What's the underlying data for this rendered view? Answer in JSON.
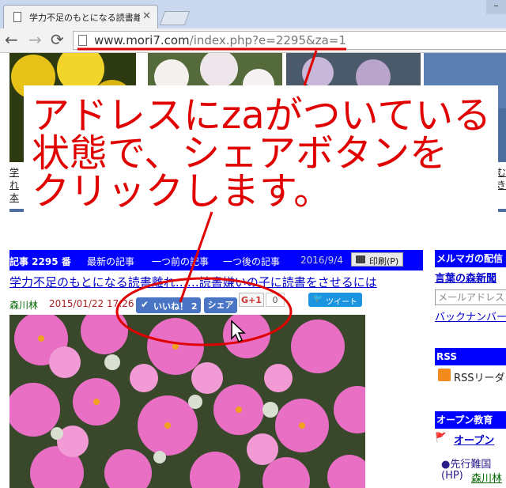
{
  "browser": {
    "tab_title": "学力不足のもとになる読書離",
    "tab_close": "✕",
    "back": "←",
    "forward": "→",
    "reload": "⟳",
    "url_host": "www.mori7.com",
    "url_path": "/index.php?e=2295&za=1",
    "icons": [
      "page-icon",
      "back-icon",
      "forward-icon",
      "reload-icon",
      "close-icon"
    ]
  },
  "thumbnails": {
    "captions": [
      "学",
      "れ",
      "本",
      "む",
      "き"
    ]
  },
  "article_bar": {
    "title": "記事 2295 番",
    "links": [
      "最新の記事",
      "一つ前の記事",
      "一つ後の記事"
    ],
    "date": "2016/9/4",
    "print_label": "印刷(P)"
  },
  "article": {
    "title": "学力不足のもとになる読書離れ……読書嫌いの子に読書をさせるには",
    "author": "森川林",
    "published": "2015/01/22 17:26",
    "like_label": "いいね！ 2",
    "share_label": "シェア",
    "gplus_label": "G+1",
    "gplus_count": "0",
    "tweet_label": "ツイート"
  },
  "sidebar": {
    "mailmag_heading": "メルマガの配信",
    "mailmag_link": "言葉の森新聞",
    "mail_placeholder": "メールアドレス",
    "backnumber_link": "バックナンバー",
    "rss_heading": "RSS",
    "rss_link": "RSSリーダー",
    "open_heading": "オープン教育",
    "open_link": "オープン",
    "senko_text": "●先行難国",
    "hp_text": "(HP)",
    "hp_link": "森川林"
  },
  "annotation": {
    "lines": [
      "アドレスにzaがついている",
      "状態で、シェアボタンを",
      "クリックします。"
    ]
  },
  "colors": {
    "annotation_red": "#e00000",
    "bar_blue": "#0000ff",
    "fb_blue": "#4a74c4"
  }
}
